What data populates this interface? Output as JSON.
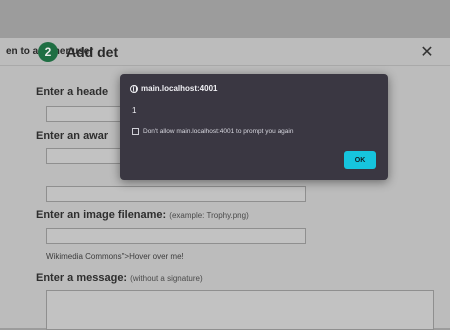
{
  "modal": {
    "title": "en to another user",
    "close_label": "✕"
  },
  "step": {
    "number": "2",
    "title": "Add det"
  },
  "form": {
    "header_label": "Enter a heade",
    "award_label": "Enter an awar",
    "image_label": "Enter an image filename:",
    "image_hint": "(example: Trophy.png)",
    "wikimedia_text": "Wikimedia Commons\">Hover over me!",
    "message_label": "Enter a message:",
    "message_hint": "(without a signature)"
  },
  "dialog": {
    "origin": "main.localhost:4001",
    "message": "1",
    "checkbox_label": "Don't allow main.localhost:4001 to prompt you again",
    "ok_label": "OK",
    "accent_color": "#16c5de"
  }
}
